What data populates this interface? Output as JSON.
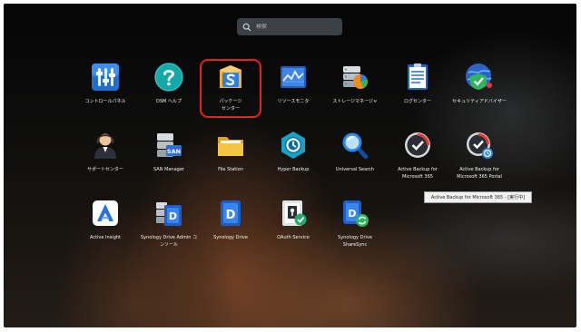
{
  "search": {
    "placeholder": "検索"
  },
  "apps": [
    {
      "label": "コントロールパネル",
      "icon": "control-panel-icon"
    },
    {
      "label": "DSM ヘルプ",
      "icon": "help-icon"
    },
    {
      "label": "パッケージ\nセンター",
      "icon": "package-center-icon"
    },
    {
      "label": "リソースモニタ",
      "icon": "resource-monitor-icon"
    },
    {
      "label": "ストレージマネージャ",
      "icon": "storage-manager-icon"
    },
    {
      "label": "ログセンター",
      "icon": "log-center-icon"
    },
    {
      "label": "セキュリティアドバイザー",
      "icon": "security-advisor-icon"
    },
    {
      "label": "サポートセンター",
      "icon": "support-center-icon"
    },
    {
      "label": "SAN Manager",
      "icon": "san-manager-icon"
    },
    {
      "label": "File Station",
      "icon": "file-station-icon"
    },
    {
      "label": "Hyper Backup",
      "icon": "hyper-backup-icon"
    },
    {
      "label": "Universal Search",
      "icon": "universal-search-icon"
    },
    {
      "label": "Active Backup for\nMicrosoft 365",
      "icon": "active-backup-365-icon"
    },
    {
      "label": "Active Backup for\nMicrosoft 365 Portal",
      "icon": "active-backup-365-portal-icon"
    },
    {
      "label": "Active Insight",
      "icon": "active-insight-icon"
    },
    {
      "label": "Synology Drive Admin コ\nンソール",
      "icon": "drive-admin-console-icon"
    },
    {
      "label": "Synology Drive",
      "icon": "synology-drive-icon"
    },
    {
      "label": "OAuth Service",
      "icon": "oauth-service-icon"
    },
    {
      "label": "Synology Drive\nShareSync",
      "icon": "drive-sharesync-icon"
    }
  ],
  "tooltip": {
    "text": "Active Backup for Microsoft 365 - [実行中]"
  },
  "highlight": {
    "target": "パッケージセンター",
    "color": "#e2231a"
  }
}
